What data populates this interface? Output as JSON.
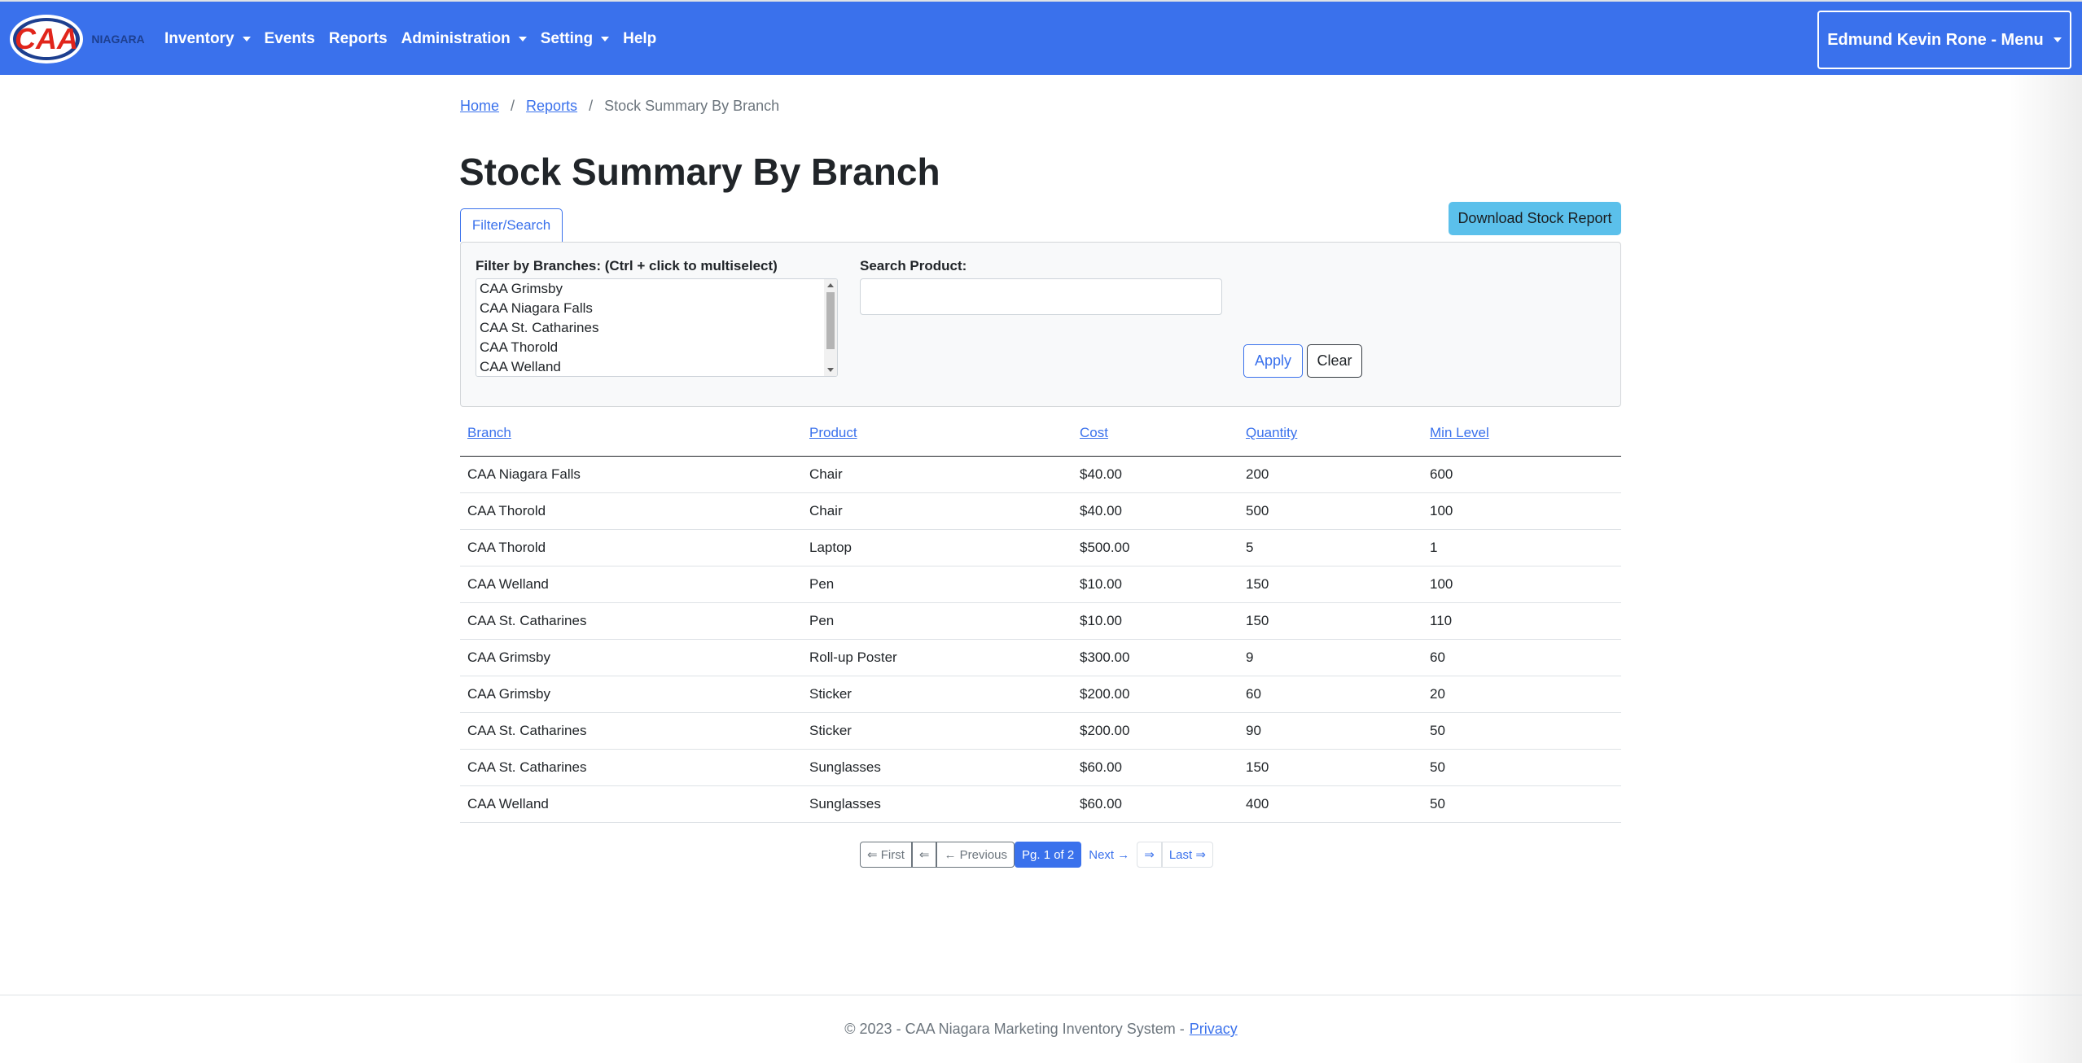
{
  "navbar": {
    "logo_text": "CAA",
    "logo_sub": "NIAGARA",
    "items": [
      {
        "label": "Inventory",
        "dropdown": true
      },
      {
        "label": "Events",
        "dropdown": false
      },
      {
        "label": "Reports",
        "dropdown": false
      },
      {
        "label": "Administration",
        "dropdown": true
      },
      {
        "label": "Setting",
        "dropdown": true
      },
      {
        "label": "Help",
        "dropdown": false
      }
    ],
    "user_menu": "Edmund Kevin Rone - Menu"
  },
  "breadcrumb": {
    "home": "Home",
    "reports": "Reports",
    "current": "Stock Summary By Branch"
  },
  "page_title": "Stock Summary By Branch",
  "filter": {
    "toggle_label": "Filter/Search",
    "download_label": "Download Stock Report",
    "branches_label": "Filter by Branches: (Ctrl + click to multiselect)",
    "branches": [
      "CAA Grimsby",
      "CAA Niagara Falls",
      "CAA St. Catharines",
      "CAA Thorold",
      "CAA Welland"
    ],
    "search_label": "Search Product:",
    "search_value": "",
    "apply_label": "Apply",
    "clear_label": "Clear"
  },
  "table": {
    "headers": [
      "Branch",
      "Product",
      "Cost",
      "Quantity",
      "Min Level"
    ],
    "rows": [
      [
        "CAA Niagara Falls",
        "Chair",
        "$40.00",
        "200",
        "600"
      ],
      [
        "CAA Thorold",
        "Chair",
        "$40.00",
        "500",
        "100"
      ],
      [
        "CAA Thorold",
        "Laptop",
        "$500.00",
        "5",
        "1"
      ],
      [
        "CAA Welland",
        "Pen",
        "$10.00",
        "150",
        "100"
      ],
      [
        "CAA St. Catharines",
        "Pen",
        "$10.00",
        "150",
        "110"
      ],
      [
        "CAA Grimsby",
        "Roll-up Poster",
        "$300.00",
        "9",
        "60"
      ],
      [
        "CAA Grimsby",
        "Sticker",
        "$200.00",
        "60",
        "20"
      ],
      [
        "CAA St. Catharines",
        "Sticker",
        "$200.00",
        "90",
        "50"
      ],
      [
        "CAA St. Catharines",
        "Sunglasses",
        "$60.00",
        "150",
        "50"
      ],
      [
        "CAA Welland",
        "Sunglasses",
        "$60.00",
        "400",
        "50"
      ]
    ]
  },
  "pagination": {
    "first": "⇐ First",
    "prev_arrow": "⇐",
    "previous": "← Previous",
    "current": "Pg. 1 of 2",
    "next": "Next →",
    "next_arrow": "⇒",
    "last": "Last ⇒"
  },
  "footer": {
    "text": "© 2023 - CAA Niagara Marketing Inventory System -",
    "privacy": "Privacy"
  },
  "colors": {
    "navbar": "#3a71ec",
    "download_button": "#5bc0eb",
    "link": "#3a71ec"
  }
}
